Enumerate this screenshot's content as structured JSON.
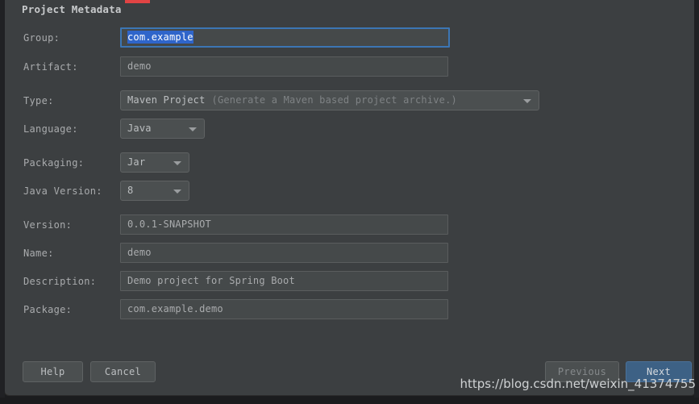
{
  "dialog": {
    "title": "Project Metadata",
    "accent_color": "#3c76b4",
    "selection_color": "#2f65ca",
    "marker_color": "#e14444",
    "background_color": "#3c3f41"
  },
  "form": {
    "group": {
      "label": "Group:",
      "value": "com.example",
      "focused": true,
      "selected": true
    },
    "artifact": {
      "label": "Artifact:",
      "value": "demo"
    },
    "type": {
      "label": "Type:",
      "value": "Maven Project",
      "hint": "(Generate a Maven based project archive.)",
      "arrow_icon": "chevron-down-icon"
    },
    "language": {
      "label": "Language:",
      "value": "Java",
      "arrow_icon": "chevron-down-icon"
    },
    "packaging": {
      "label": "Packaging:",
      "value": "Jar",
      "arrow_icon": "chevron-down-icon"
    },
    "java_version": {
      "label": "Java Version:",
      "value": "8",
      "arrow_icon": "chevron-down-icon"
    },
    "version": {
      "label": "Version:",
      "value": "0.0.1-SNAPSHOT"
    },
    "name": {
      "label": "Name:",
      "value": "demo"
    },
    "description": {
      "label": "Description:",
      "value": "Demo project for Spring Boot"
    },
    "package": {
      "label": "Package:",
      "value": "com.example.demo"
    }
  },
  "footer": {
    "help": "Help",
    "cancel": "Cancel",
    "previous": "Previous",
    "next": "Next"
  },
  "watermark": {
    "text": "https://blog.csdn.net/weixin_41374755"
  }
}
